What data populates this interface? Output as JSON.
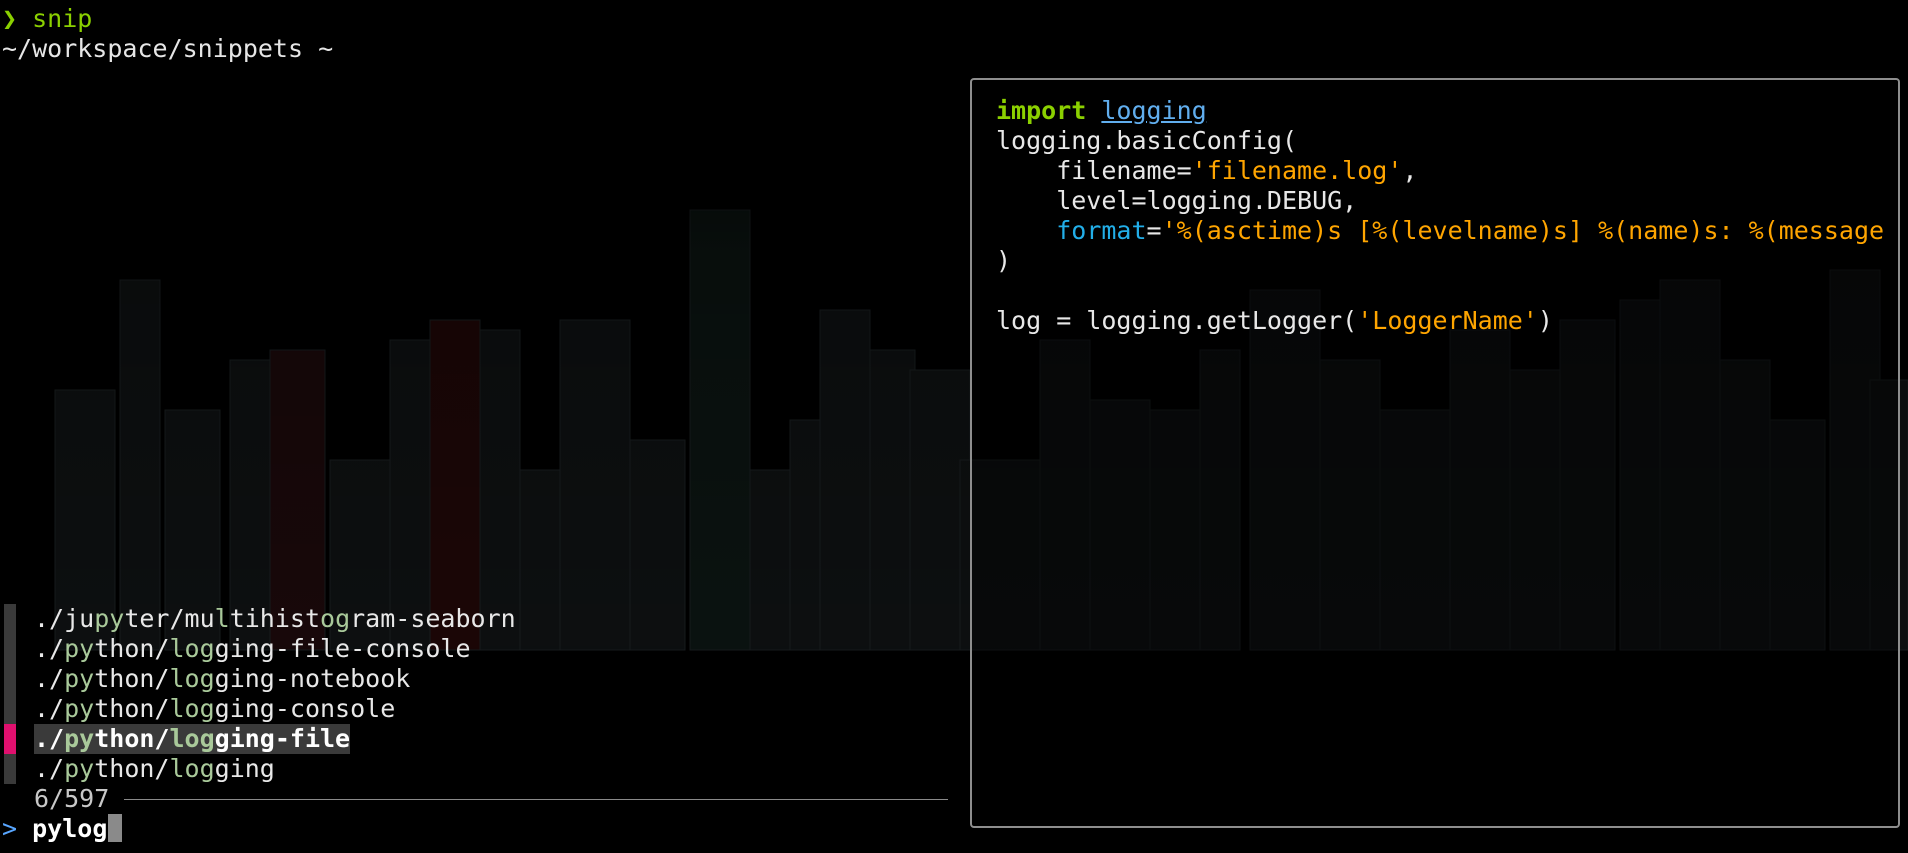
{
  "prompt": {
    "chevron": "❯",
    "command": "snip",
    "cwd": "~/workspace/snippets ~"
  },
  "results": [
    {
      "segments": [
        [
          "./ju",
          false
        ],
        [
          "py",
          true
        ],
        [
          "ter/mu",
          false
        ],
        [
          "l",
          true
        ],
        [
          "tihist",
          false
        ],
        [
          "og",
          true
        ],
        [
          "ram-seaborn",
          false
        ]
      ],
      "selected": false
    },
    {
      "segments": [
        [
          "./",
          false
        ],
        [
          "py",
          true
        ],
        [
          "thon/",
          false
        ],
        [
          "log",
          true
        ],
        [
          "ging-file-console",
          false
        ]
      ],
      "selected": false
    },
    {
      "segments": [
        [
          "./",
          false
        ],
        [
          "py",
          true
        ],
        [
          "thon/",
          false
        ],
        [
          "log",
          true
        ],
        [
          "ging-notebook",
          false
        ]
      ],
      "selected": false
    },
    {
      "segments": [
        [
          "./",
          false
        ],
        [
          "py",
          true
        ],
        [
          "thon/",
          false
        ],
        [
          "log",
          true
        ],
        [
          "ging-console",
          false
        ]
      ],
      "selected": false
    },
    {
      "segments": [
        [
          "./",
          false
        ],
        [
          "py",
          true
        ],
        [
          "thon/",
          false
        ],
        [
          "log",
          true
        ],
        [
          "ging-file",
          false
        ]
      ],
      "selected": true
    },
    {
      "segments": [
        [
          "./",
          false
        ],
        [
          "py",
          true
        ],
        [
          "thon/",
          false
        ],
        [
          "log",
          true
        ],
        [
          "ging",
          false
        ]
      ],
      "selected": false
    }
  ],
  "count": "6/597",
  "query": {
    "prompt": ">",
    "text": "pylog"
  },
  "preview": {
    "lines": [
      [
        [
          "import",
          "kw"
        ],
        [
          " ",
          ""
        ],
        [
          "logging",
          "mod"
        ]
      ],
      [
        [
          "logging.basicConfig(",
          ""
        ]
      ],
      [
        [
          "    filename=",
          ""
        ],
        [
          "'filename.log'",
          "str"
        ],
        [
          ",",
          ""
        ]
      ],
      [
        [
          "    level=logging.DEBUG,",
          ""
        ]
      ],
      [
        [
          "    ",
          ""
        ],
        [
          "format",
          "kwarg"
        ],
        [
          "=",
          ""
        ],
        [
          "'%(asctime)s [%(levelname)s] %(name)s: %(message",
          "str"
        ]
      ],
      [
        [
          ")",
          ""
        ]
      ],
      [
        [
          "",
          ""
        ]
      ],
      [
        [
          "log = logging.getLogger(",
          ""
        ],
        [
          "'LoggerName'",
          "str"
        ],
        [
          ")",
          ""
        ]
      ]
    ]
  },
  "colors": {
    "selection_marker": "#e0106e",
    "prompt_green": "#8bd000",
    "string_orange": "#ffa500",
    "keyword_arg_blue": "#22aee8",
    "query_prompt_blue": "#58a6ff"
  }
}
